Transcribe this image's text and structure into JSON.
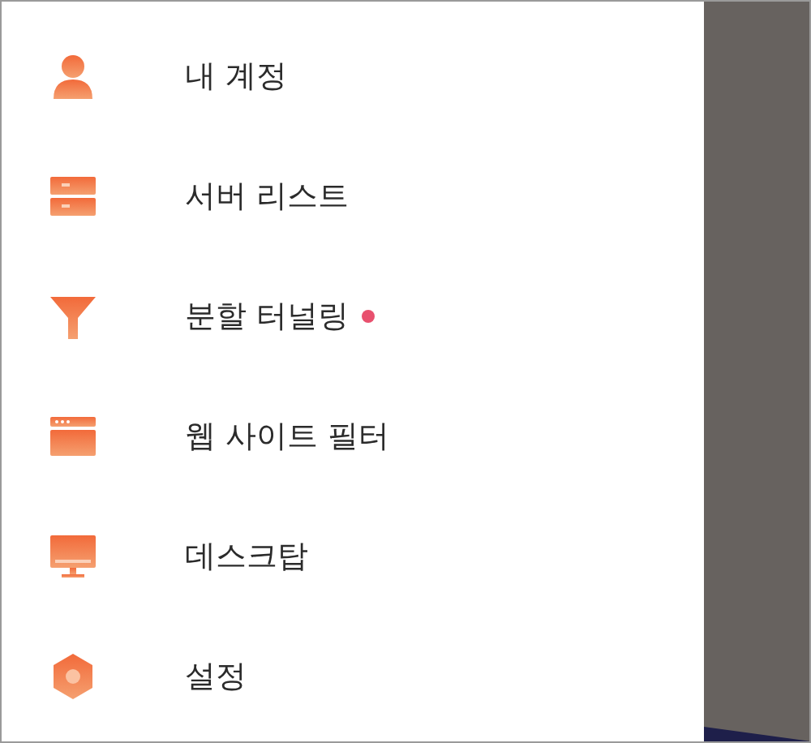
{
  "menu": [
    {
      "kind": "account",
      "label": "내 계정",
      "dot": false
    },
    {
      "kind": "servers",
      "label": "서버 리스트",
      "dot": false
    },
    {
      "kind": "split",
      "label": "분할 터널링",
      "dot": true
    },
    {
      "kind": "web",
      "label": "웹 사이트 필터",
      "dot": false
    },
    {
      "kind": "desktop",
      "label": "데스크탑",
      "dot": false
    },
    {
      "kind": "settings",
      "label": "설정",
      "dot": false
    }
  ]
}
